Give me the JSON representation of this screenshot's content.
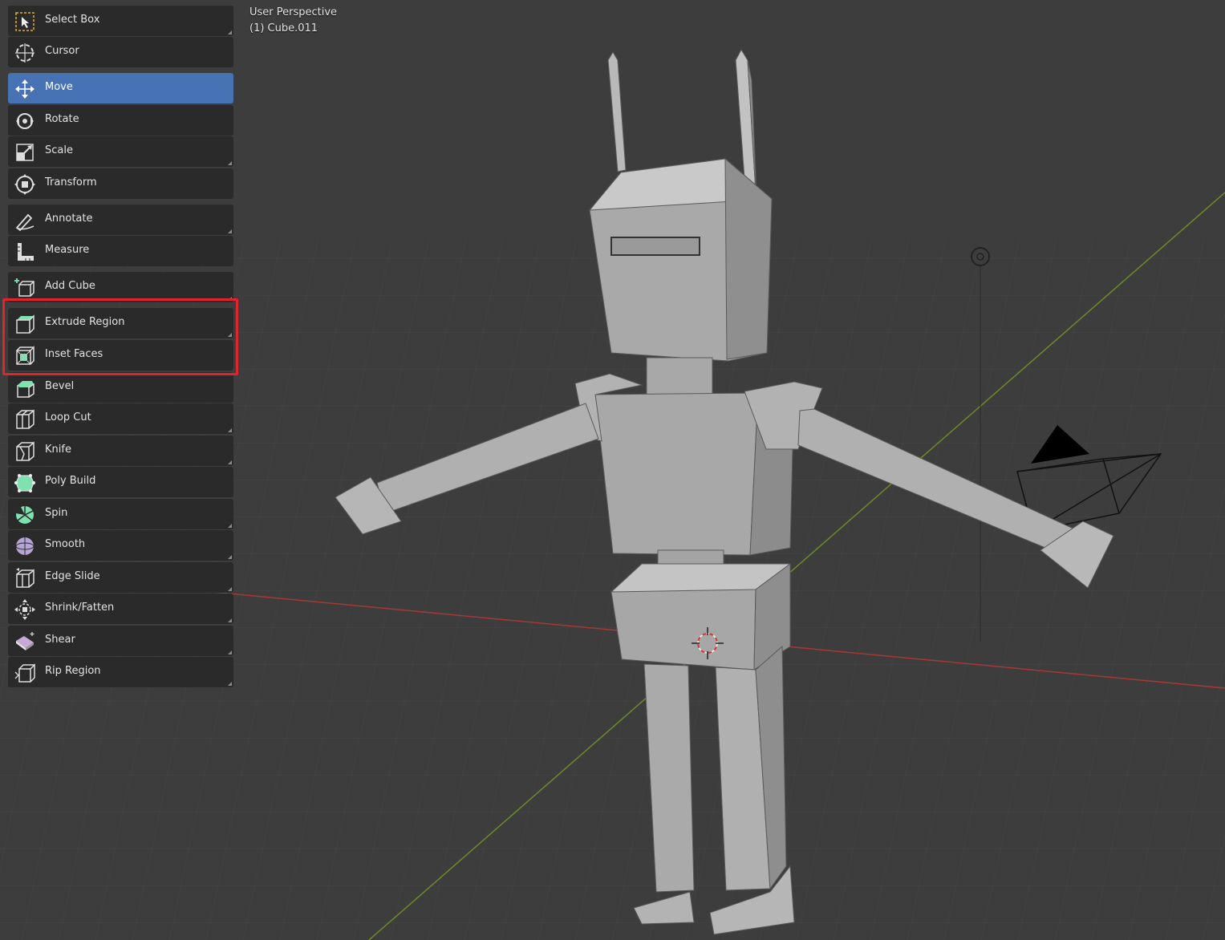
{
  "viewport": {
    "view_label": "User Perspective",
    "object_label": "(1) Cube.011"
  },
  "highlight": {
    "color": "#e3242b",
    "covers": [
      "Extrude Region",
      "Inset Faces"
    ]
  },
  "colors": {
    "active_tool": "#4772b3",
    "tool_bg": "#2a2a2a",
    "viewport_bg": "#3d3d3d",
    "x_axis": "#b23a3a",
    "y_axis": "#6f8f2a",
    "mesh_accent": "#7fe0b0"
  },
  "toolbar": {
    "tools": [
      {
        "label": "Select Box",
        "icon": "select-box-icon",
        "active": false,
        "has_submenu": true
      },
      {
        "label": "Cursor",
        "icon": "cursor-icon",
        "active": false,
        "has_submenu": false
      },
      {
        "label": "Move",
        "icon": "move-icon",
        "active": true,
        "has_submenu": false
      },
      {
        "label": "Rotate",
        "icon": "rotate-icon",
        "active": false,
        "has_submenu": false
      },
      {
        "label": "Scale",
        "icon": "scale-icon",
        "active": false,
        "has_submenu": true
      },
      {
        "label": "Transform",
        "icon": "transform-icon",
        "active": false,
        "has_submenu": false
      },
      {
        "label": "Annotate",
        "icon": "annotate-icon",
        "active": false,
        "has_submenu": true
      },
      {
        "label": "Measure",
        "icon": "measure-icon",
        "active": false,
        "has_submenu": false
      },
      {
        "label": "Add Cube",
        "icon": "add-cube-icon",
        "active": false,
        "has_submenu": true
      },
      {
        "label": "Extrude Region",
        "icon": "extrude-region-icon",
        "active": false,
        "has_submenu": true
      },
      {
        "label": "Inset Faces",
        "icon": "inset-faces-icon",
        "active": false,
        "has_submenu": false
      },
      {
        "label": "Bevel",
        "icon": "bevel-icon",
        "active": false,
        "has_submenu": false
      },
      {
        "label": "Loop Cut",
        "icon": "loop-cut-icon",
        "active": false,
        "has_submenu": true
      },
      {
        "label": "Knife",
        "icon": "knife-icon",
        "active": false,
        "has_submenu": true
      },
      {
        "label": "Poly Build",
        "icon": "poly-build-icon",
        "active": false,
        "has_submenu": false
      },
      {
        "label": "Spin",
        "icon": "spin-icon",
        "active": false,
        "has_submenu": true
      },
      {
        "label": "Smooth",
        "icon": "smooth-icon",
        "active": false,
        "has_submenu": true
      },
      {
        "label": "Edge Slide",
        "icon": "edge-slide-icon",
        "active": false,
        "has_submenu": true
      },
      {
        "label": "Shrink/Fatten",
        "icon": "shrink-fatten-icon",
        "active": false,
        "has_submenu": true
      },
      {
        "label": "Shear",
        "icon": "shear-icon",
        "active": false,
        "has_submenu": true
      },
      {
        "label": "Rip Region",
        "icon": "rip-region-icon",
        "active": false,
        "has_submenu": true
      }
    ]
  }
}
